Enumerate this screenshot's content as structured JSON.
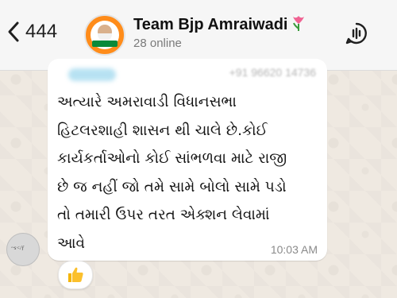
{
  "header": {
    "back_count": "444",
    "group_name": "Team Bjp Amraiwadi",
    "group_emoji_icon": "tulip-icon",
    "status": "28 online",
    "action_icon": "voice-chat-icon"
  },
  "message": {
    "sender_phone": "+91 96620 14736",
    "lines": [
      "અત્યારે અમરાવાડી વિધાનસભા",
      "હિટલરશાહી શાસન થી ચાલે છે.કોઈ",
      "કાર્યકર્તાઓનો કોઈ સાંભળવા માટે રાજી",
      "છે જ નહીં જો તમે સામે બોલો સામે પડો",
      "તો તમારી ઉપર તરત એક્શન લેવામાં",
      "આવે"
    ],
    "time": "10:03 AM",
    "reaction_icon": "thumbs-up-icon"
  },
  "colors": {
    "header_bg": "#f6f6f6",
    "bubble_bg": "#ffffff",
    "wallpaper": "#efe9e1",
    "avatar_orange": "#ff8c1a"
  }
}
